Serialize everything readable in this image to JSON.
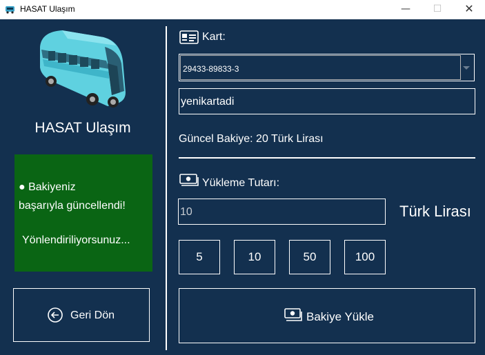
{
  "window": {
    "title": "HASAT Ulaşım",
    "controls": {
      "minimize": "—",
      "maximize": "☐",
      "close": "✕"
    }
  },
  "sidebar": {
    "brand": "HASAT Ulaşım",
    "message": {
      "line1": "● Bakiyeniz",
      "line2": "başarıyla güncellendi!",
      "line3": "Yönlendiriliyorsunuz..."
    },
    "back_button": "Geri Dön"
  },
  "main": {
    "card_label": "Kart:",
    "card_select_value": "29433-89833-3",
    "card_name_value": "yenikartadi",
    "balance_text": "Güncel Bakiye: 20 Türk Lirası",
    "amount_label": "Yükleme Tutarı:",
    "amount_value": "10",
    "currency": "Türk Lirası",
    "quick_amounts": [
      "5",
      "10",
      "50",
      "100"
    ],
    "load_button": "Bakiye Yükle"
  },
  "colors": {
    "background": "#13304f",
    "message_box": "#0a6514",
    "text": "#ffffff"
  },
  "icons": [
    "bus-icon",
    "card-icon",
    "money-icon",
    "back-arrow-icon",
    "chevron-down-icon"
  ]
}
